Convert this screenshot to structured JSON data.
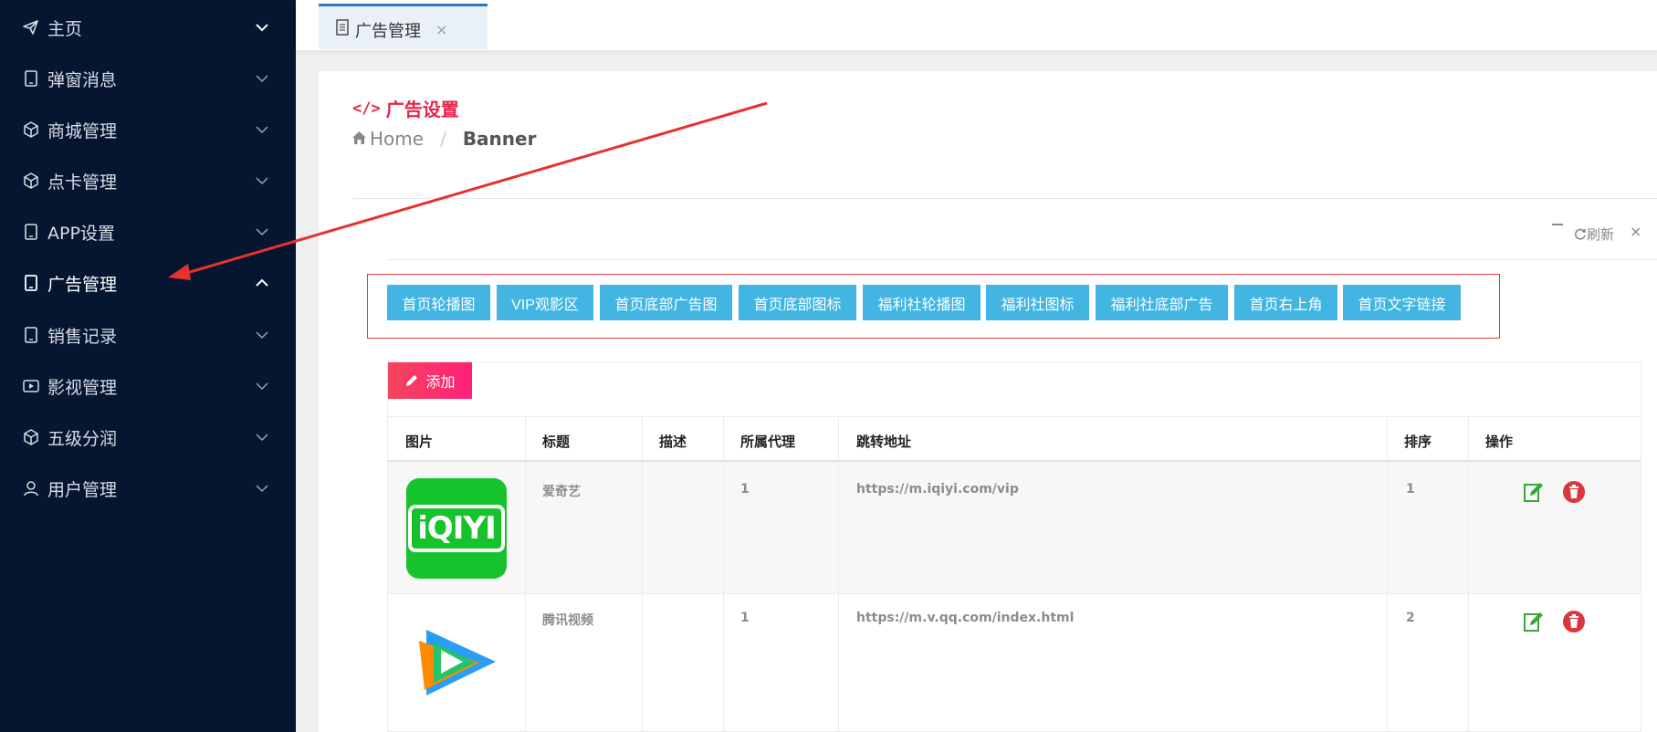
{
  "sidebar": {
    "items": [
      {
        "label": "主页",
        "icon": "send-icon",
        "chevron": "down"
      },
      {
        "label": "弹窗消息",
        "icon": "tablet-icon",
        "chevron": "down"
      },
      {
        "label": "商城管理",
        "icon": "cube-icon",
        "chevron": "down"
      },
      {
        "label": "点卡管理",
        "icon": "cube-icon",
        "chevron": "down"
      },
      {
        "label": "APP设置",
        "icon": "tablet-icon",
        "chevron": "down"
      },
      {
        "label": "广告管理",
        "icon": "tablet-icon",
        "chevron": "up",
        "active": true
      },
      {
        "label": "销售记录",
        "icon": "tablet-icon",
        "chevron": "down"
      },
      {
        "label": "影视管理",
        "icon": "video-icon",
        "chevron": "down"
      },
      {
        "label": "五级分润",
        "icon": "cube-icon",
        "chevron": "down"
      },
      {
        "label": "用户管理",
        "icon": "user-icon",
        "chevron": "down"
      }
    ]
  },
  "tabs": [
    {
      "label": "广告管理",
      "close": "×"
    }
  ],
  "section": {
    "title": "广告设置",
    "breadcrumb_home": "Home",
    "breadcrumb_sep": "/",
    "breadcrumb_current": "Banner"
  },
  "toolbar": {
    "refresh_label": "刷新",
    "close_label": "×"
  },
  "categories": [
    "首页轮播图",
    "VIP观影区",
    "首页底部广告图",
    "首页底部图标",
    "福利社轮播图",
    "福利社图标",
    "福利社底部广告",
    "首页右上角",
    "首页文字链接"
  ],
  "add_button": {
    "label": "添加"
  },
  "table": {
    "columns": [
      "图片",
      "标题",
      "描述",
      "所属代理",
      "跳转地址",
      "排序",
      "操作"
    ],
    "rows": [
      {
        "image": "iQIYI",
        "title": "爱奇艺",
        "description": "",
        "agent": "1",
        "url": "https://m.iqiyi.com/vip",
        "sort": "1"
      },
      {
        "image": "tencent-video-logo",
        "title": "腾讯视频",
        "description": "",
        "agent": "1",
        "url": "https://m.v.qq.com/index.html",
        "sort": "2"
      }
    ]
  },
  "colors": {
    "sidebar_bg": "#061530",
    "accent_red": "#e8234a",
    "category_button": "#42b5e2",
    "add_button": "#ff1f7a",
    "edit_icon": "#3aa63a",
    "delete_icon": "#d9363e",
    "annotation_arrow": "#e8312e"
  }
}
